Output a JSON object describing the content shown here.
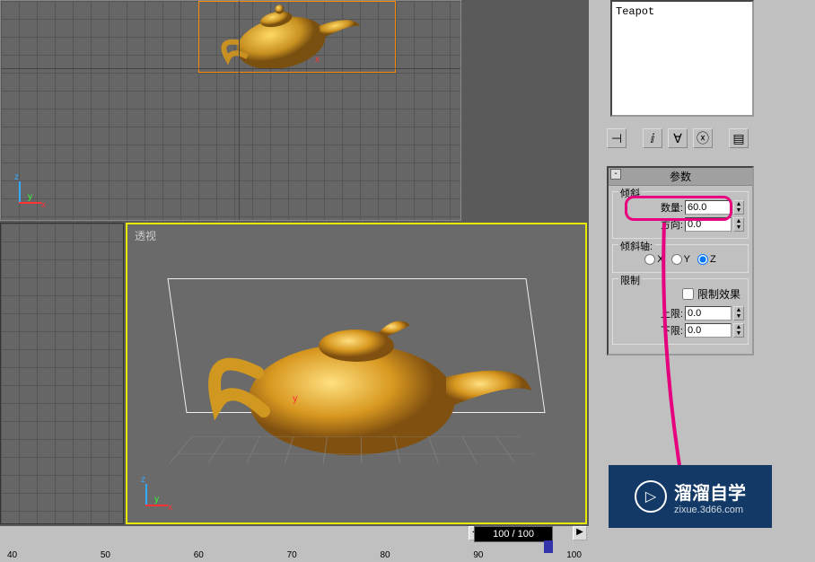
{
  "object_list": {
    "selected": "Teapot"
  },
  "toolbar": {
    "pin_icon": "📌",
    "sep1": "|",
    "link_icon": "⛓",
    "unlink_icon": "❌",
    "sel_icon": "◎",
    "more_icon": "⋯"
  },
  "rollout": {
    "title": "参数",
    "toggle": "-",
    "skew": {
      "legend": "倾斜",
      "amount_label": "数量:",
      "amount_value": "60.0",
      "direction_label": "方向:",
      "direction_value": "0.0"
    },
    "skew_axis": {
      "legend": "倾斜轴:",
      "x": "X",
      "y": "Y",
      "z": "Z",
      "selected": "z"
    },
    "limit": {
      "legend": "限制",
      "effect_label": "限制效果",
      "upper_label": "上限:",
      "upper_value": "0.0",
      "lower_label": "下限:",
      "lower_value": "0.0"
    }
  },
  "viewports": {
    "perspective_label": "透视"
  },
  "axes": {
    "x": "x",
    "y": "y",
    "z": "z"
  },
  "timeline": {
    "frame_display": "100 / 100",
    "ticks": [
      "40",
      "50",
      "60",
      "70",
      "80",
      "90",
      "100"
    ]
  },
  "watermark": {
    "title": "溜溜自学",
    "url": "zixue.3d66.com"
  }
}
